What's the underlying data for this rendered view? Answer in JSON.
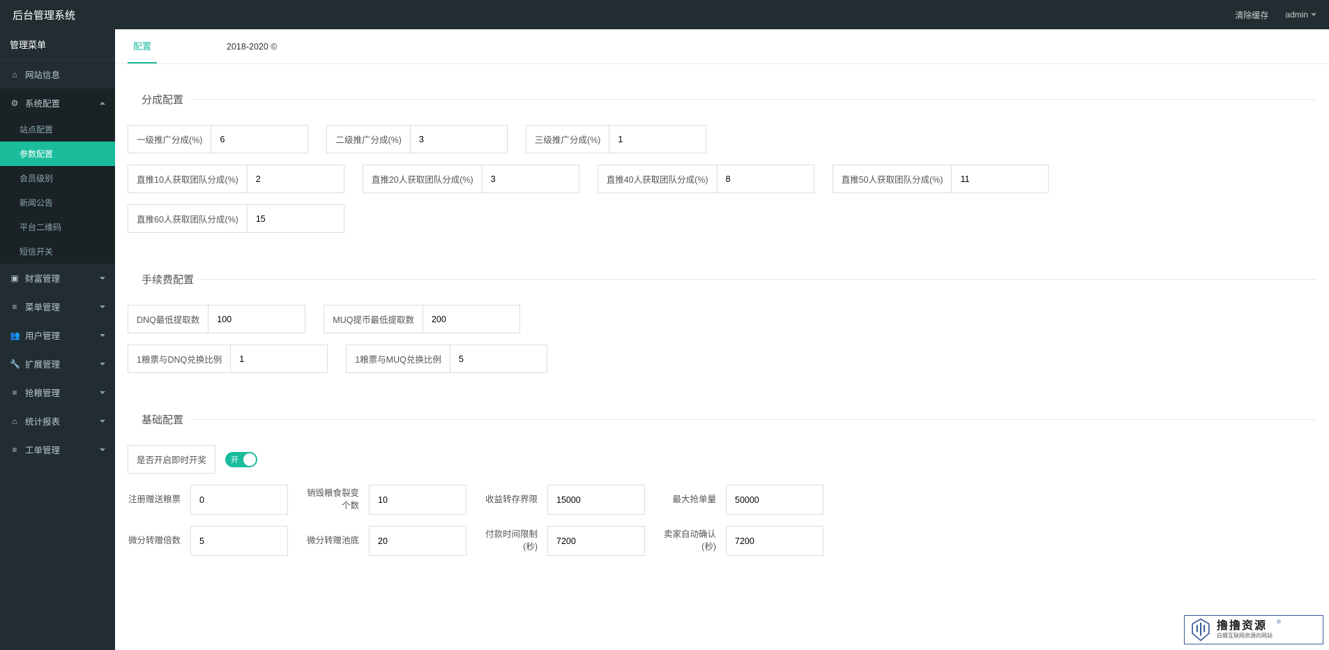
{
  "header": {
    "brand": "后台管理系统",
    "clear_cache": "清除缓存",
    "user": "admin"
  },
  "sidebar": {
    "heading": "管理菜单",
    "items": [
      {
        "icon": "home",
        "label": "网站信息",
        "children": null
      },
      {
        "icon": "cogs",
        "label": "系统配置",
        "expanded": true,
        "children": [
          {
            "label": "站点配置",
            "active": false
          },
          {
            "label": "参数配置",
            "active": true
          },
          {
            "label": "会员级别",
            "active": false
          },
          {
            "label": "新闻公告",
            "active": false
          },
          {
            "label": "平台二维码",
            "active": false
          },
          {
            "label": "短信开关",
            "active": false
          }
        ]
      },
      {
        "icon": "wallet",
        "label": "财富管理",
        "children": []
      },
      {
        "icon": "list",
        "label": "菜单管理",
        "children": []
      },
      {
        "icon": "users",
        "label": "用户管理",
        "children": []
      },
      {
        "icon": "wrench",
        "label": "扩展管理",
        "children": []
      },
      {
        "icon": "list",
        "label": "抢粮管理",
        "children": []
      },
      {
        "icon": "home",
        "label": "统计报表",
        "children": []
      },
      {
        "icon": "list",
        "label": "工单管理",
        "children": []
      }
    ]
  },
  "tab": {
    "title": "配置"
  },
  "copyright": "2018-2020 ©",
  "section_commission": {
    "legend": "分成配置",
    "level1": {
      "label": "一级推广分成(%)",
      "value": "6"
    },
    "level2": {
      "label": "二级推广分成(%)",
      "value": "3"
    },
    "level3": {
      "label": "三级推广分成(%)",
      "value": "1"
    },
    "direct10": {
      "label": "直推10人获取团队分成(%)",
      "value": "2"
    },
    "direct20": {
      "label": "直推20人获取团队分成(%)",
      "value": "3"
    },
    "direct40": {
      "label": "直推40人获取团队分成(%)",
      "value": "8"
    },
    "direct50": {
      "label": "直推50人获取团队分成(%)",
      "value": "11"
    },
    "direct60": {
      "label": "直推60人获取团队分成(%)",
      "value": "15"
    }
  },
  "section_fee": {
    "legend": "手续费配置",
    "dnq_min": {
      "label": "DNQ最低提取数",
      "value": "100"
    },
    "muq_min": {
      "label": "MUQ提币最低提取数",
      "value": "200"
    },
    "ratio_dnq": {
      "label": "1粮票与DNQ兑换比例",
      "value": "1"
    },
    "ratio_muq": {
      "label": "1粮票与MUQ兑换比例",
      "value": "5"
    }
  },
  "section_basic": {
    "legend": "基础配置",
    "instant_lottery": {
      "label": "是否开启即时开奖",
      "state_text": "开",
      "on": true
    },
    "register_gift": {
      "label": "注册赠送粮票",
      "value": "0"
    },
    "destroy_split_l1": "销毁粮食裂变",
    "destroy_split_l2": "个数",
    "destroy_split": {
      "value": "10"
    },
    "profit_limit": {
      "label": "收益转存界限",
      "value": "15000"
    },
    "max_order": {
      "label": "最大抢单量",
      "value": "50000"
    },
    "micro_multi": {
      "label": "微分转赠倍数",
      "value": "5"
    },
    "micro_base": {
      "label": "微分转赠池底",
      "value": "20"
    },
    "pay_timeout_l1": "付款时间限制",
    "pay_timeout_l2": "(秒)",
    "pay_timeout": {
      "value": "7200"
    },
    "auto_confirm_l1": "卖家自动确认",
    "auto_confirm_l2": "(秒)",
    "auto_confirm": {
      "value": "7200"
    }
  },
  "watermark": {
    "main": "撸撸资源",
    "sub": "白嫖互联网资源的网站"
  }
}
